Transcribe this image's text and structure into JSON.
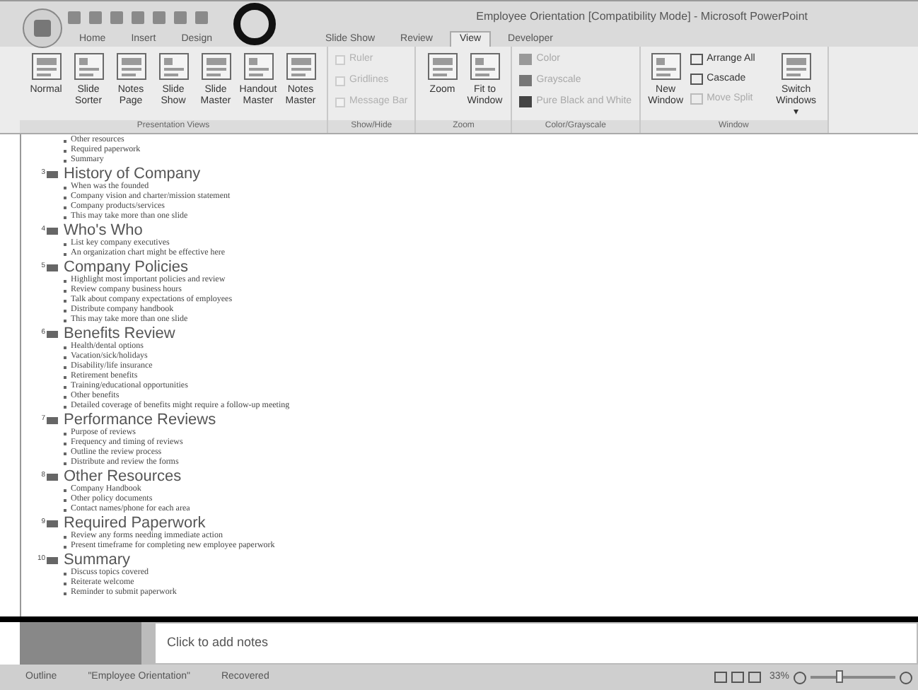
{
  "window": {
    "title": "Employee Orientation [Compatibility Mode] - Microsoft PowerPoint"
  },
  "tabs": [
    {
      "label": "Home",
      "selected": false
    },
    {
      "label": "Insert",
      "selected": false
    },
    {
      "label": "Design",
      "selected": false
    },
    {
      "label": "Slide Show",
      "selected": false
    },
    {
      "label": "Review",
      "selected": false
    },
    {
      "label": "View",
      "selected": true
    },
    {
      "label": "Developer",
      "selected": false
    }
  ],
  "ribbon_groups": [
    {
      "label": "Presentation Views",
      "kind": "big",
      "items": [
        {
          "label": "Normal",
          "disabled": false
        },
        {
          "label": "Slide Sorter",
          "disabled": false
        },
        {
          "label": "Notes Page",
          "disabled": false
        },
        {
          "label": "Slide Show",
          "disabled": false
        },
        {
          "label": "Slide Master",
          "disabled": false
        },
        {
          "label": "Handout Master",
          "disabled": false
        },
        {
          "label": "Notes Master",
          "disabled": false
        }
      ]
    },
    {
      "label": "Show/Hide",
      "kind": "checks",
      "items": [
        {
          "label": "Ruler",
          "disabled": true
        },
        {
          "label": "Gridlines",
          "disabled": true
        },
        {
          "label": "Message Bar",
          "disabled": true
        }
      ]
    },
    {
      "label": "Zoom",
      "kind": "big",
      "items": [
        {
          "label": "Zoom",
          "disabled": false
        },
        {
          "label": "Fit to Window",
          "disabled": false
        }
      ]
    },
    {
      "label": "Color/Grayscale",
      "kind": "small",
      "items": [
        {
          "label": "Color",
          "disabled": true
        },
        {
          "label": "Grayscale",
          "disabled": true
        },
        {
          "label": "Pure Black and White",
          "disabled": true
        }
      ]
    },
    {
      "label": "Window",
      "kind": "window",
      "items": [
        {
          "label": "New Window",
          "disabled": false
        },
        {
          "label": "Arrange All",
          "disabled": false
        },
        {
          "label": "Cascade",
          "disabled": false
        },
        {
          "label": "Move Split",
          "disabled": true
        },
        {
          "label": "Switch Windows ▾",
          "disabled": false
        }
      ]
    }
  ],
  "outline": {
    "leading_bullets": [
      "Other resources",
      "Required paperwork",
      "Summary"
    ],
    "slides": [
      {
        "number": "3",
        "title": "History of Company",
        "bullets": [
          "When was the founded",
          "Company vision and charter/mission statement",
          "Company products/services",
          "This may take more than one slide"
        ]
      },
      {
        "number": "4",
        "title": "Who's Who",
        "bullets": [
          "List key company executives",
          "An organization chart might be effective here"
        ]
      },
      {
        "number": "5",
        "title": "Company Policies",
        "bullets": [
          "Highlight most important policies and review",
          "Review company business hours",
          "Talk about company expectations of employees",
          "Distribute company handbook",
          "This may take more than one slide"
        ]
      },
      {
        "number": "6",
        "title": "Benefits Review",
        "bullets": [
          "Health/dental options",
          "Vacation/sick/holidays",
          "Disability/life insurance",
          "Retirement benefits",
          "Training/educational opportunities",
          "Other benefits",
          "Detailed coverage of benefits might require a follow-up meeting"
        ]
      },
      {
        "number": "7",
        "title": "Performance Reviews",
        "bullets": [
          "Purpose of reviews",
          "Frequency and timing of reviews",
          "Outline the review process",
          "Distribute and review the forms"
        ]
      },
      {
        "number": "8",
        "title": "Other Resources",
        "bullets": [
          "Company Handbook",
          "Other policy documents",
          "Contact names/phone for each area"
        ]
      },
      {
        "number": "9",
        "title": "Required Paperwork",
        "bullets": [
          "Review any forms needing immediate action",
          "Present timeframe for completing new employee paperwork"
        ]
      },
      {
        "number": "10",
        "title": "Summary",
        "bullets": [
          "Discuss topics covered",
          "Reiterate welcome",
          "Reminder to submit paperwork"
        ]
      }
    ]
  },
  "notes": {
    "placeholder": "Click to add notes"
  },
  "status_bar": {
    "items": [
      "Outline",
      "\"Employee Orientation\"",
      "Recovered"
    ],
    "zoom": "33%"
  }
}
